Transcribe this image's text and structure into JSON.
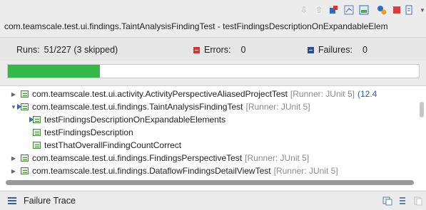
{
  "window": {
    "title_line": "com.teamscale.test.ui.findings.TaintAnalysisFindingTest - testFindingsDescriptionOnExpandableElem"
  },
  "toolbar": {
    "icons": [
      "arrow-down-icon",
      "arrow-up-icon",
      "relaunch-icon",
      "history-icon",
      "stop-icon",
      "layout-icon",
      "menu-icon"
    ]
  },
  "stats": {
    "runs_label": "Runs:",
    "runs_value": "51/227 (3 skipped)",
    "errors_label": "Errors:",
    "errors_value": "0",
    "failures_label": "Failures:",
    "failures_value": "0"
  },
  "progress": {
    "fraction": 0.2247,
    "color": "#35b84a"
  },
  "tree": {
    "rows": [
      {
        "kind": "class",
        "expanded": false,
        "name": "com.teamscale.test.ui.activity.ActivityPerspectiveAliasedProjectTest",
        "runner": "[Runner: JUnit 5]",
        "extra": "(12.4"
      },
      {
        "kind": "class",
        "expanded": true,
        "name": "com.teamscale.test.ui.findings.TaintAnalysisFindingTest",
        "runner": "[Runner: JUnit 5]",
        "extra": ""
      },
      {
        "kind": "method",
        "running": true,
        "name": "testFindingsDescriptionOnExpandableElements",
        "runner": "",
        "extra": ""
      },
      {
        "kind": "method",
        "running": false,
        "name": "testFindingsDescription",
        "runner": "",
        "extra": ""
      },
      {
        "kind": "method",
        "running": false,
        "name": "testThatOverallFindingCountCorrect",
        "runner": "",
        "extra": ""
      },
      {
        "kind": "class",
        "expanded": false,
        "name": "com.teamscale.test.ui.findings.FindingsPerspectiveTest",
        "runner": "[Runner: JUnit 5]",
        "extra": ""
      },
      {
        "kind": "class",
        "expanded": false,
        "name": "com.teamscale.test.ui.findings.DataflowFindingsDetailViewTest",
        "runner": "[Runner: JUnit 5]",
        "extra": ""
      }
    ]
  },
  "failure_trace": {
    "label": "Failure Trace"
  }
}
